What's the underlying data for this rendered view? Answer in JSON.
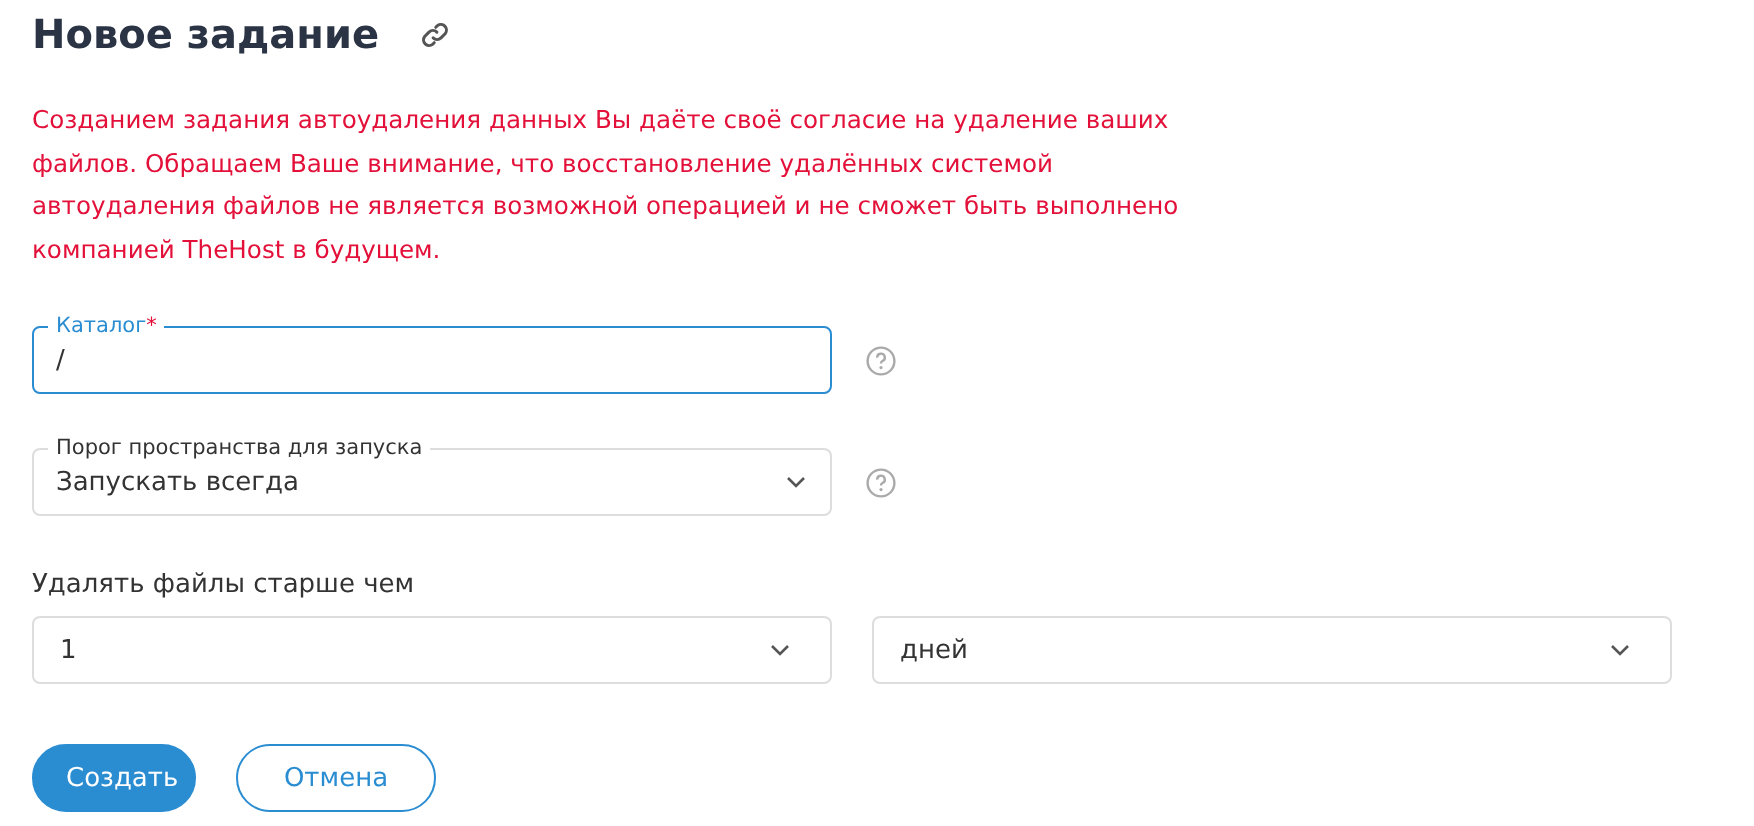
{
  "title": "Новое задание",
  "warning": "Созданием задания автоудаления данных Вы даёте своё согласие на удаление ваших файлов. Обращаем Ваше внимание, что восстановление удалённых системой автоудаления файлов не является возможной операцией и не сможет быть выполнено компанией TheHost в будущем.",
  "fields": [
    {
      "kind": "input",
      "label": "Каталог",
      "required_mark": "*",
      "value": "/",
      "focused": true,
      "help": true
    },
    {
      "kind": "select",
      "label": "Порог пространства для запуска",
      "value": "Запускать всегда",
      "focused": false,
      "help": true
    }
  ],
  "age": {
    "label": "Удалять файлы старше чем",
    "selects": [
      {
        "value": "1"
      },
      {
        "value": "дней"
      }
    ]
  },
  "buttons": [
    {
      "kind": "primary",
      "label": "Создать"
    },
    {
      "kind": "secondary",
      "label": "Отмена"
    }
  ]
}
